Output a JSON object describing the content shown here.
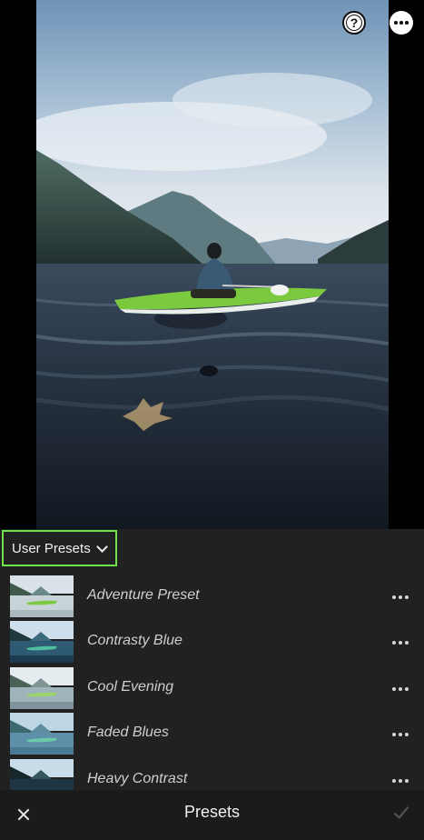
{
  "toolbar": {
    "help_glyph": "?",
    "help_icon": "help-circle-icon",
    "more_icon": "more-horizontal-icon"
  },
  "group_selector": {
    "label": "User Presets",
    "icon": "chevron-down-icon",
    "highlight_color": "#6ee24a"
  },
  "presets": [
    {
      "name": "Adventure Preset"
    },
    {
      "name": "Contrasty Blue"
    },
    {
      "name": "Cool Evening"
    },
    {
      "name": "Faded Blues"
    },
    {
      "name": "Heavy Contrast"
    }
  ],
  "bottom_bar": {
    "title": "Presets",
    "close_icon": "close-icon",
    "confirm_icon": "checkmark-icon"
  },
  "colors": {
    "panel_bg": "#212121",
    "bottom_bar_bg": "#1b1b1b",
    "accent": "#6ee24a"
  }
}
